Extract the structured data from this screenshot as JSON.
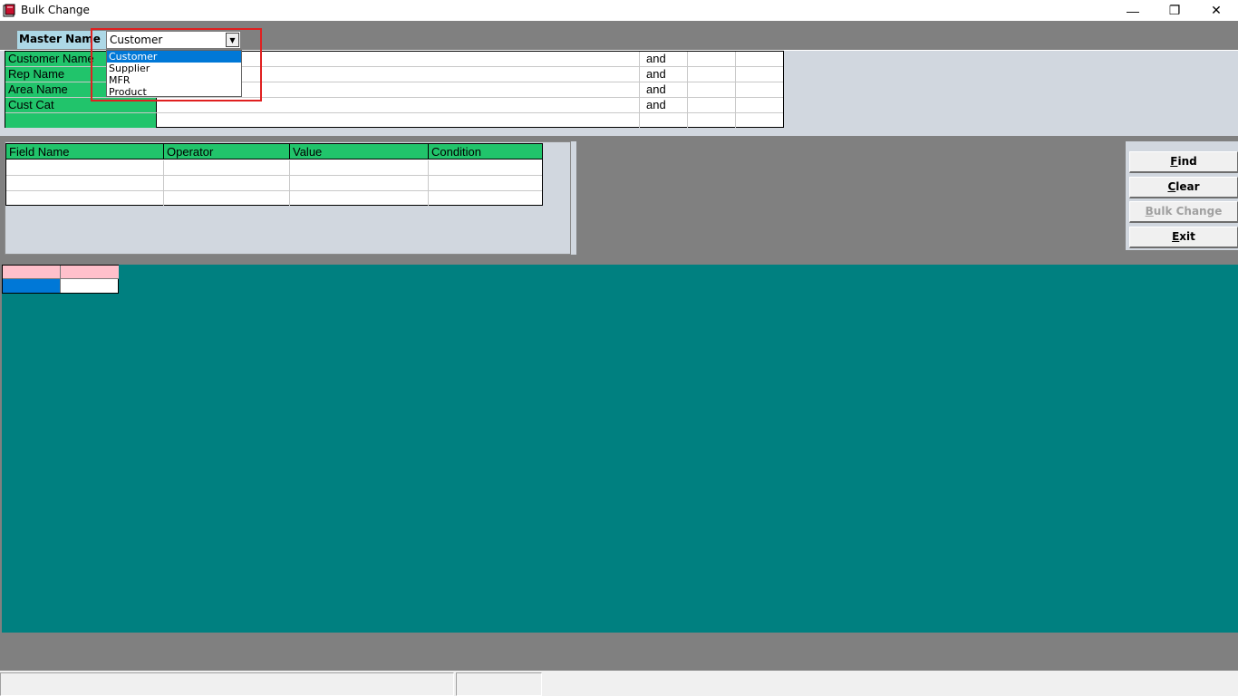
{
  "window": {
    "title": "Bulk Change",
    "minimize_glyph": "—",
    "maximize_glyph": "❐",
    "close_glyph": "✕"
  },
  "master": {
    "label": "Master Name",
    "selected": "Customer",
    "options": [
      "Customer",
      "Supplier",
      "MFR",
      "Product"
    ]
  },
  "criteria": {
    "rows": [
      {
        "label": "Customer Name",
        "value": "",
        "conj": "and"
      },
      {
        "label": "Rep Name",
        "value": "",
        "conj": "and"
      },
      {
        "label": "Area Name",
        "value": "",
        "conj": "and"
      },
      {
        "label": "Cust Cat",
        "value": "",
        "conj": "and"
      },
      {
        "label": "",
        "value": "",
        "conj": ""
      }
    ]
  },
  "conditions": {
    "headers": [
      "Field Name",
      "Operator",
      "Value",
      "Condition"
    ],
    "rows": [
      [
        "",
        "",
        "",
        ""
      ],
      [
        "",
        "",
        "",
        ""
      ],
      [
        "",
        "",
        "",
        ""
      ]
    ]
  },
  "buttons": {
    "find": "Find",
    "clear": "Clear",
    "bulk_change": "Bulk Change",
    "exit": "Exit"
  },
  "status": {
    "pane1": "",
    "pane2": ""
  },
  "colors": {
    "grid_header_green": "#21c46b",
    "master_label_blue": "#add8e6",
    "results_teal": "#008080",
    "panel_gray": "#d1d7df",
    "selection_blue": "#0078d7",
    "highlight_red": "#e02020",
    "mini_header_pink": "#ffc0cb"
  }
}
